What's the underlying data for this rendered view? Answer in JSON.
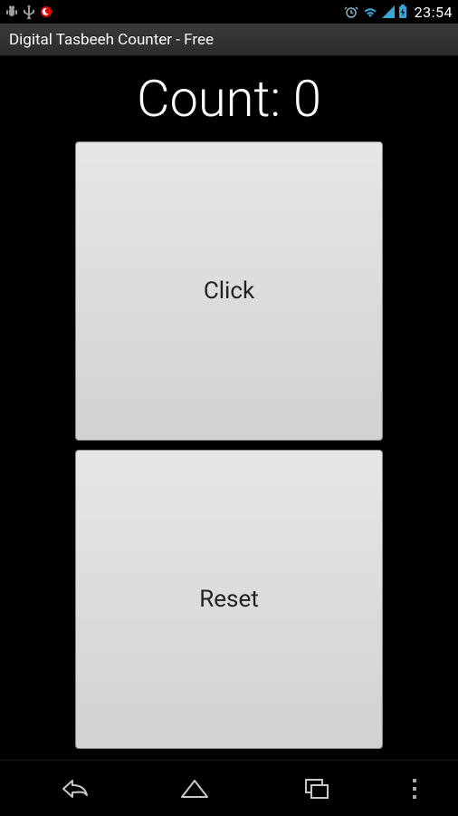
{
  "statusbar": {
    "time": "23:54"
  },
  "titlebar": {
    "title": "Digital Tasbeeh Counter - Free"
  },
  "main": {
    "count_label": "Count: 0",
    "click_label": "Click",
    "reset_label": "Reset"
  }
}
